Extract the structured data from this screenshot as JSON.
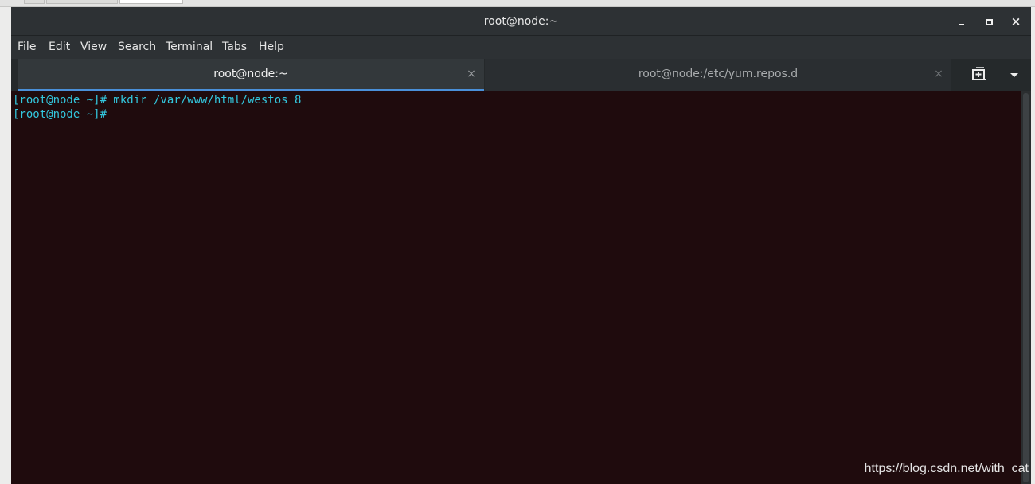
{
  "window": {
    "title": "root@node:~"
  },
  "menubar": {
    "items": [
      "File",
      "Edit",
      "View",
      "Search",
      "Terminal",
      "Tabs",
      "Help"
    ]
  },
  "tabs": [
    {
      "label": "root@node:~",
      "active": true,
      "close_glyph": "×"
    },
    {
      "label": "root@node:/etc/yum.repos.d",
      "active": false,
      "close_glyph": "×"
    }
  ],
  "terminal": {
    "lines": [
      "[root@node ~]# mkdir /var/www/html/westos_8",
      "[root@node ~]#"
    ],
    "text_color": "#33c7de",
    "background_color": "#1f0b0d"
  },
  "icons": {
    "minimize": "minimize-icon",
    "maximize": "maximize-icon",
    "close": "close-icon",
    "new_tab": "new-tab-icon",
    "tab_menu": "chevron-down-icon"
  },
  "window_controls": {
    "close_glyph": "×"
  },
  "watermark": "https://blog.csdn.net/with_cat",
  "colors": {
    "accent": "#4a90d9",
    "titlebar": "#2d3134"
  }
}
